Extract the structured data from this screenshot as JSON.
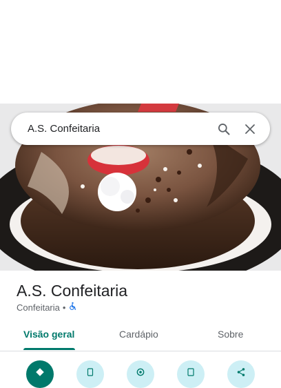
{
  "search": {
    "query": "A.S. Confeitaria"
  },
  "place": {
    "name": "A.S. Confeitaria",
    "category": "Confeitaria",
    "separator": "•"
  },
  "tabs": [
    {
      "label": "Visão geral",
      "active": true
    },
    {
      "label": "Cardápio",
      "active": false
    },
    {
      "label": "Sobre",
      "active": false
    }
  ],
  "actions": [
    {
      "icon": "directions-icon",
      "primary": true
    },
    {
      "icon": "phone-icon"
    },
    {
      "icon": "share-location-icon"
    },
    {
      "icon": "save-icon"
    },
    {
      "icon": "share-icon"
    }
  ],
  "colors": {
    "accent": "#00796b",
    "chip_bg": "#cdeff5",
    "accessibility": "#1a73e8"
  }
}
